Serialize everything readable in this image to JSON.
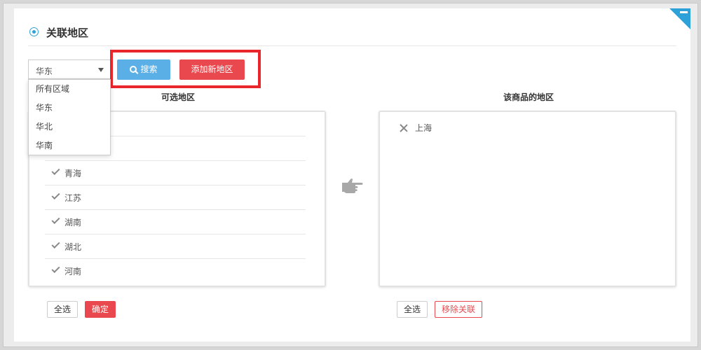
{
  "header": {
    "title": "关联地区"
  },
  "region_select": {
    "value": "华东",
    "options": [
      "所有区域",
      "华东",
      "华北",
      "华南"
    ]
  },
  "toolbar": {
    "search_label": "搜索",
    "add_label": "添加新地区"
  },
  "available": {
    "heading": "可选地区",
    "items": [
      "青海",
      "江苏",
      "湖南",
      "湖北",
      "河南"
    ]
  },
  "assigned": {
    "heading": "该商品的地区",
    "items": [
      "上海"
    ]
  },
  "left_actions": {
    "select_all": "全选",
    "confirm": "确定"
  },
  "right_actions": {
    "select_all": "全选",
    "remove": "移除关联"
  },
  "colors": {
    "accent": "#2ea1d8",
    "primary_btn": "#5aafe6",
    "danger": "#e9494e",
    "highlight": "#e9262b"
  },
  "icons": {
    "search": "search-icon",
    "check": "check-icon",
    "remove": "close-icon",
    "transfer": "pointing-hand-icon"
  }
}
